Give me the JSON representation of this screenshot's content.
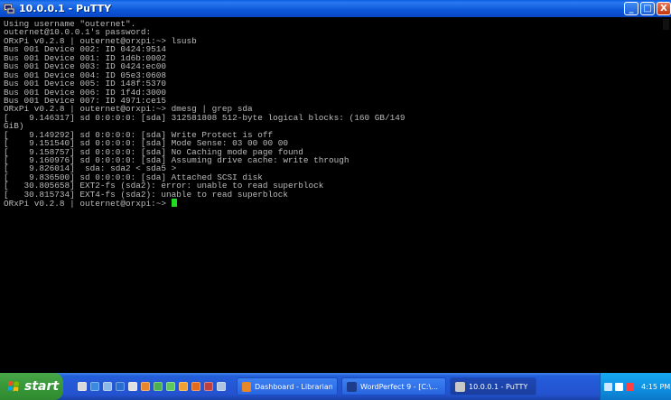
{
  "window": {
    "title": "10.0.0.1 - PuTTY",
    "min_glyph": "_",
    "max_glyph": "□",
    "close_glyph": "X"
  },
  "terminal": {
    "lines": [
      "Using username \"outernet\".",
      "outernet@10.0.0.1's password:",
      "ORxPi v0.2.8 | outernet@orxpi:~> lsusb",
      "Bus 001 Device 002: ID 0424:9514",
      "Bus 001 Device 001: ID 1d6b:0002",
      "Bus 001 Device 003: ID 0424:ec00",
      "Bus 001 Device 004: ID 05e3:0608",
      "Bus 001 Device 005: ID 148f:5370",
      "Bus 001 Device 006: ID 1f4d:3000",
      "Bus 001 Device 007: ID 4971:ce15",
      "ORxPi v0.2.8 | outernet@orxpi:~> dmesg | grep sda",
      "[    9.146317] sd 0:0:0:0: [sda] 312581808 512-byte logical blocks: (160 GB/149",
      "GiB)",
      "[    9.149292] sd 0:0:0:0: [sda] Write Protect is off",
      "[    9.151540] sd 0:0:0:0: [sda] Mode Sense: 03 00 00 00",
      "[    9.158757] sd 0:0:0:0: [sda] No Caching mode page found",
      "[    9.160976] sd 0:0:0:0: [sda] Assuming drive cache: write through",
      "[    9.826014]  sda: sda2 < sda5 >",
      "[    9.836500] sd 0:0:0:0: [sda] Attached SCSI disk",
      "[   30.805658] EXT2-fs (sda2): error: unable to read superblock",
      "[   30.815734] EXT4-fs (sda2): unable to read superblock"
    ],
    "prompt": "ORxPi v0.2.8 | outernet@orxpi:~> ",
    "cursor_color": "#22dd22"
  },
  "taskbar": {
    "start_label": "start",
    "quick_launch_icons": [
      {
        "name": "notepad-icon",
        "color": "#d9d9d9"
      },
      {
        "name": "ie-icon",
        "color": "#3a8be0"
      },
      {
        "name": "network-icon",
        "color": "#8bb7e6"
      },
      {
        "name": "media-icon",
        "color": "#2a6fcf"
      },
      {
        "name": "speaker-icon",
        "color": "#e0e0e0"
      },
      {
        "name": "firefox-icon",
        "color": "#e8862a"
      },
      {
        "name": "chrome-icon",
        "color": "#4caf50"
      },
      {
        "name": "edit-icon",
        "color": "#5cc85c"
      },
      {
        "name": "ball-icon",
        "color": "#f0a030"
      },
      {
        "name": "fox-icon",
        "color": "#e46a1c"
      },
      {
        "name": "apps-icon",
        "color": "#c04040"
      },
      {
        "name": "settings-icon",
        "color": "#b0c4e0"
      }
    ],
    "tasks": [
      {
        "label": "Dashboard - Librarian...",
        "icon": "browser-icon",
        "icon_color": "#e8862a",
        "active": false
      },
      {
        "label": "WordPerfect 9 - [C:\\...",
        "icon": "wordperfect-icon",
        "icon_color": "#1e3c8c",
        "active": false
      },
      {
        "label": "10.0.0.1 - PuTTY",
        "icon": "putty-icon",
        "icon_color": "#c8c8c8",
        "active": true
      }
    ],
    "tray_icons": [
      {
        "name": "back-arrow-icon",
        "color": "#cfe6ff"
      },
      {
        "name": "volume-icon",
        "color": "#ffffff"
      },
      {
        "name": "network-tray-icon",
        "color": "#ff4040"
      }
    ],
    "clock": "4:15 PM"
  }
}
